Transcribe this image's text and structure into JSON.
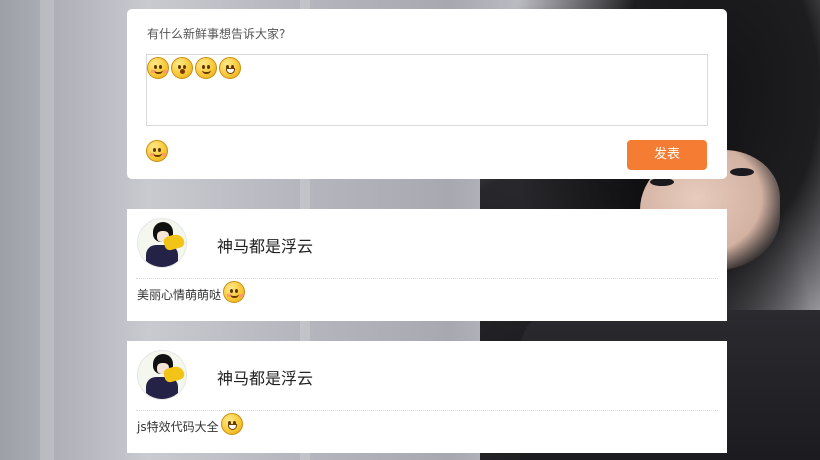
{
  "compose": {
    "prompt": "有什么新鲜事想告诉大家?",
    "inserted_emojis": [
      "kiss-emoji-icon",
      "surprised-emoji-icon",
      "tongue-emoji-icon",
      "grin-emoji-icon"
    ],
    "emoji_button_icon": "blush-emoji-icon",
    "submit_label": "发表",
    "submit_color": "#f57d33"
  },
  "posts": [
    {
      "author": "神马都是浮云",
      "text": "美丽心情萌萌哒",
      "emoji": "blush-emoji-icon"
    },
    {
      "author": "神马都是浮云",
      "text": "js特效代码大全",
      "emoji": "grin-emoji-icon"
    }
  ]
}
